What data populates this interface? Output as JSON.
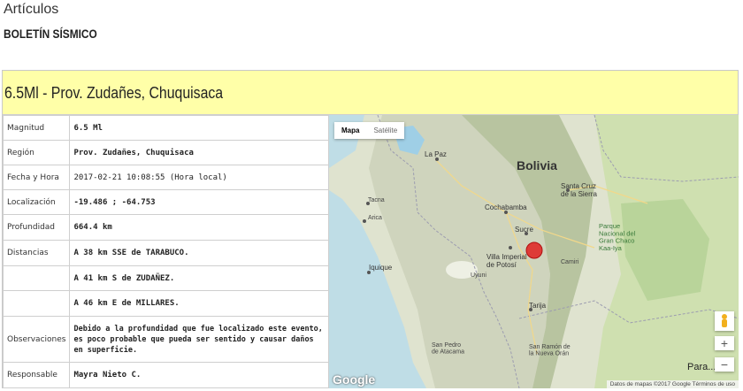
{
  "breadcrumb": "Artículos",
  "section_title": "BOLETÍN SÍSMICO",
  "event_title": "6.5Ml - Prov. Zudañes, Chuquisaca",
  "rows": [
    {
      "label": "Magnitud",
      "value": "6.5 Ml"
    },
    {
      "label": "Región",
      "value": "Prov. Zudañes, Chuquisaca"
    },
    {
      "label": "Fecha y Hora",
      "value": "2017-02-21 10:08:55 (Hora local)"
    },
    {
      "label": "Localización",
      "value": "-19.486 ; -64.753"
    },
    {
      "label": "Profundidad",
      "value": "664.4 km"
    },
    {
      "label": "Distancias",
      "value": "A 38 km SSE de TARABUCO."
    },
    {
      "label": "",
      "value": "A 41 km S de ZUDAÑEZ."
    },
    {
      "label": "",
      "value": "A 46 km E de MILLARES."
    },
    {
      "label": "Observaciones",
      "value": "Debido a la profundidad que fue localizado este evento, es poco probable que pueda ser sentido y causar daños en superficie."
    },
    {
      "label": "Responsable",
      "value": "Mayra Nieto C."
    }
  ],
  "map": {
    "type_buttons": {
      "map": "Mapa",
      "satellite": "Satélite"
    },
    "country_label": "Bolivia",
    "places": {
      "la_paz": "La Paz",
      "cochabamba": "Cochabamba",
      "santa_cruz": "Santa Cruz\nde la Sierra",
      "sucre": "Sucre",
      "potosi": "Villa Imperial\nde Potosí",
      "uyuni": "Uyuni",
      "tacna": "Tacna",
      "arica": "Arica",
      "iquique": "Iquique",
      "tarija": "Tarija",
      "camiri": "Camiri",
      "chaco_park": "Parque\nNacional del\nGran Chaco\nKaa-Iya",
      "puerto_atacama": "San Pedro\nde Atacama",
      "paraguay": "Para...",
      "tarija_south": "San Ramón de\nla Nueva Orán"
    },
    "zoom_in": "+",
    "zoom_out": "−",
    "attribution": "Datos de mapas ©2017 Google   Términos de uso",
    "google": "Google"
  },
  "colors": {
    "title_bg": "#ffffa8",
    "epicenter": "#e02020"
  }
}
